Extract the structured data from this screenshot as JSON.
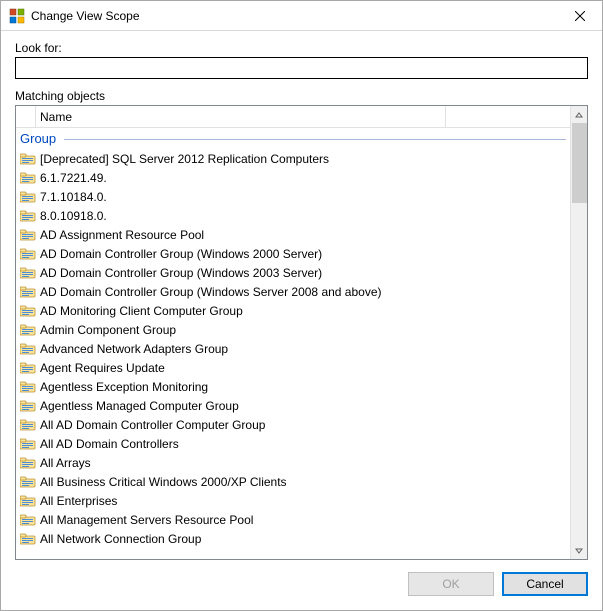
{
  "window": {
    "title": "Change View Scope"
  },
  "lookfor": {
    "label": "Look for:",
    "value": "",
    "placeholder": ""
  },
  "matching": {
    "label": "Matching objects",
    "column_header": "Name",
    "group_label": "Group",
    "items": [
      "[Deprecated] SQL Server 2012 Replication Computers",
      "6.1.7221.49.",
      "7.1.10184.0.",
      "8.0.10918.0.",
      "AD Assignment Resource Pool",
      "AD Domain Controller Group (Windows 2000 Server)",
      "AD Domain Controller Group (Windows 2003 Server)",
      "AD Domain Controller Group (Windows Server 2008 and above)",
      "AD Monitoring Client Computer Group",
      "Admin Component Group",
      "Advanced Network Adapters Group",
      "Agent Requires Update",
      "Agentless Exception Monitoring",
      "Agentless Managed Computer Group",
      "All AD Domain Controller Computer Group",
      "All AD Domain Controllers",
      "All Arrays",
      "All Business Critical Windows 2000/XP Clients",
      "All Enterprises",
      "All Management Servers Resource Pool",
      "All Network Connection Group"
    ]
  },
  "buttons": {
    "ok": "OK",
    "cancel": "Cancel"
  }
}
